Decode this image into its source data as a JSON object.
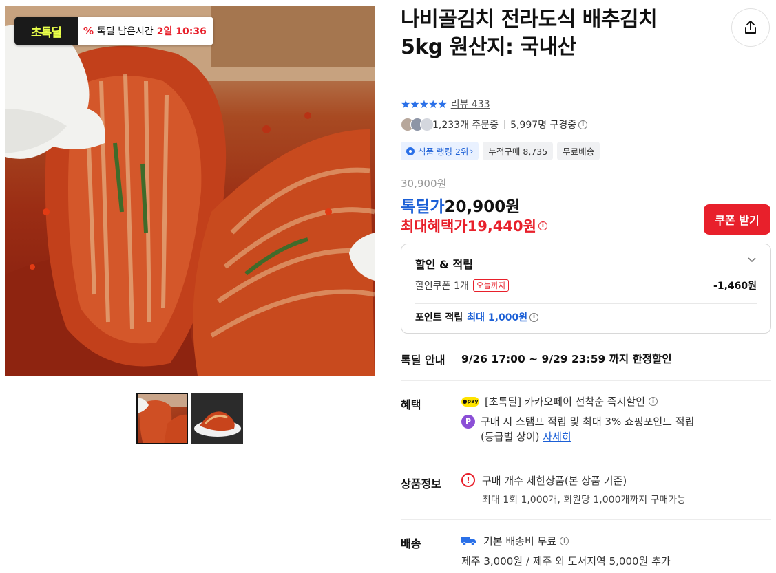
{
  "badge": {
    "logo": "초톡딜",
    "percent_icon": "%",
    "text": "톡딜 남은시간",
    "time": "2일 10:36"
  },
  "product": {
    "title": "나비골김치 전라도식 배추김치5kg 원산지: 국내산"
  },
  "rating": {
    "stars": "★★★★★",
    "review_label": "리뷰 433"
  },
  "social": {
    "ordering": "1,233개 주문중",
    "watching": "5,997명 구경중"
  },
  "tags": {
    "rank": "식품 랭킹 2위",
    "cumulative": "누적구매 8,735",
    "free_shipping": "무료배송"
  },
  "price": {
    "original": "30,900원",
    "deal_label": "톡딜가",
    "deal_value": "20,900원",
    "max_label": "최대혜택가",
    "max_value": "19,440원",
    "coupon_button": "쿠폰 받기"
  },
  "discount": {
    "heading": "할인 & 적립",
    "coupon_label": "할인쿠폰 1개",
    "coupon_tag": "오늘까지",
    "coupon_amount": "-1,460원",
    "point_label": "포인트 적립",
    "point_value": "최대 1,000원"
  },
  "deal_guide": {
    "label": "톡딜 안내",
    "text": "9/26 17:00 ~ 9/29 23:59 까지 한정할인"
  },
  "benefits": {
    "label": "혜택",
    "pay_badge": "●pay",
    "kakaopay": "[초톡딜] 카카오페이 선착순 즉시할인",
    "point_badge": "P",
    "stamp_line1": "구매 시 스탬프 적립 및 최대 3% 쇼핑포인트 적립",
    "stamp_line2": "(등급별 상이)",
    "detail_link": "자세히"
  },
  "product_info": {
    "label": "상품정보",
    "limit": "구매 개수 제한상품(본 상품 기준)",
    "limit_detail": "최대 1회 1,000개, 회원당 1,000개까지 구매가능"
  },
  "shipping": {
    "label": "배송",
    "fee": "기본 배송비 무료",
    "extra": "제주 3,000원 / 제주 외 도서지역 5,000원 추가"
  },
  "colors": {
    "accent_blue": "#1b5fd6",
    "accent_red": "#e8202b"
  }
}
